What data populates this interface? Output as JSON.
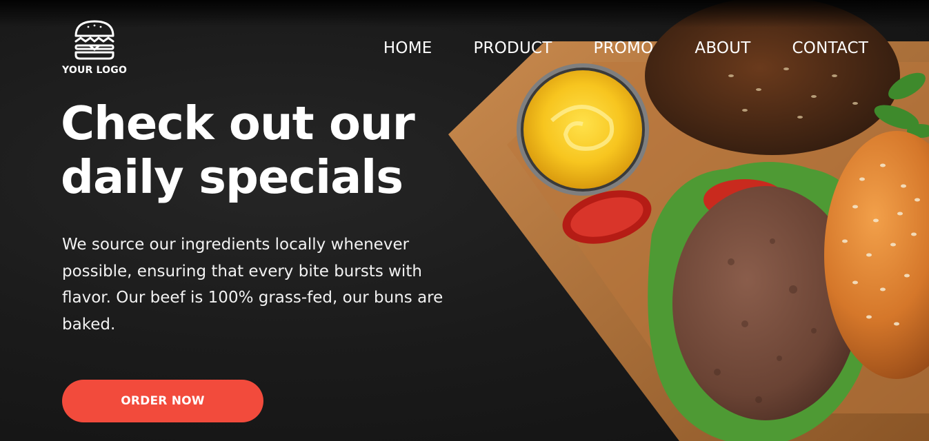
{
  "logo": {
    "text": "YOUR LOGO",
    "icon": "burger-icon"
  },
  "nav": {
    "items": [
      {
        "label": "HOME"
      },
      {
        "label": "PRODUCT"
      },
      {
        "label": "PROMO"
      },
      {
        "label": "ABOUT"
      },
      {
        "label": "CONTACT"
      }
    ]
  },
  "hero": {
    "headline_line1": "Check out our",
    "headline_line2": "daily specials",
    "description": "We source our ingredients locally whenever possible, ensuring that every bite bursts with flavor. Our beef is 100% grass-fed, our buns are baked.",
    "cta_label": "ORDER NOW",
    "image": "burger-on-wooden-board-photo"
  },
  "colors": {
    "background": "#1a1a1a",
    "accent": "#f24b3c",
    "text": "#ffffff"
  }
}
